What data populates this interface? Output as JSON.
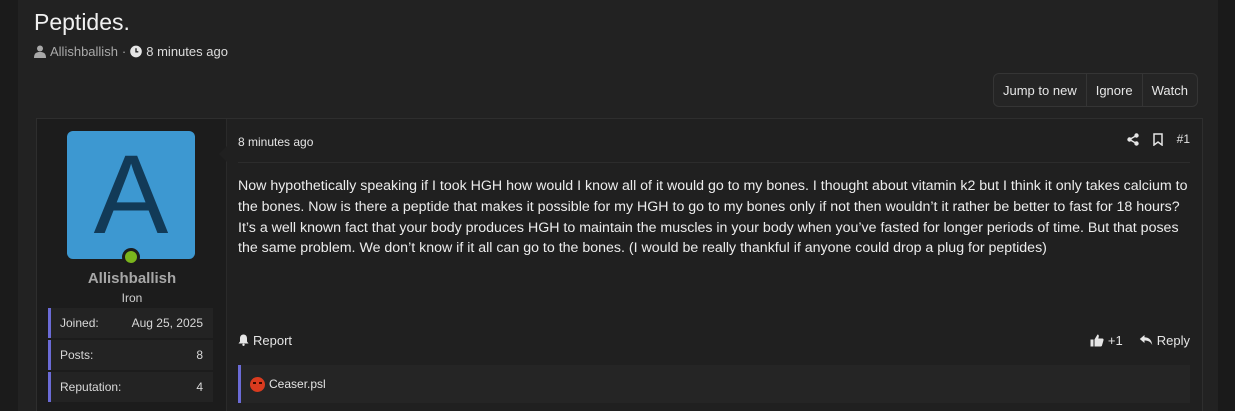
{
  "thread": {
    "title": "Peptides.",
    "author": "Allishballish",
    "separator": "·",
    "time": "8 minutes ago"
  },
  "actions": {
    "jump_to_new": "Jump to new",
    "ignore": "Ignore",
    "watch": "Watch"
  },
  "post": {
    "avatar_letter": "A",
    "username": "Allishballish",
    "user_title": "Iron",
    "stats": [
      {
        "label": "Joined:",
        "value": "Aug 25, 2025"
      },
      {
        "label": "Posts:",
        "value": "8"
      },
      {
        "label": "Reputation:",
        "value": "4"
      }
    ],
    "time": "8 minutes ago",
    "number": "#1",
    "body": "Now hypothetically speaking if I took HGH how would I know all of it would go to my bones. I thought about vitamin k2 but I think it only takes calcium to the bones. Now is there a peptide that makes it possible for my HGH to go to my bones only if not then wouldn’t it rather be better to fast for 18 hours? It’s a well known fact that your body produces HGH to maintain the muscles in your body when you’ve fasted for longer periods of time. But that poses the same problem. We don’t know if it all can go to the bones. (I would be really thankful if anyone could drop a plug for peptides)",
    "report": "Report",
    "like_count": "+1",
    "reply": "Reply",
    "reaction_user": "Ceaser.psl"
  },
  "colors": {
    "background": "#1b1b1b",
    "avatar_bg": "#3d98d1",
    "online": "#7ab51d",
    "accent": "#6b6bd6",
    "angry": "#d93b1f"
  },
  "icons": [
    "user-icon",
    "clock-icon",
    "share-icon",
    "bookmark-icon",
    "bell-icon",
    "thumbs-up-icon",
    "reply-icon",
    "angry-face-icon"
  ]
}
